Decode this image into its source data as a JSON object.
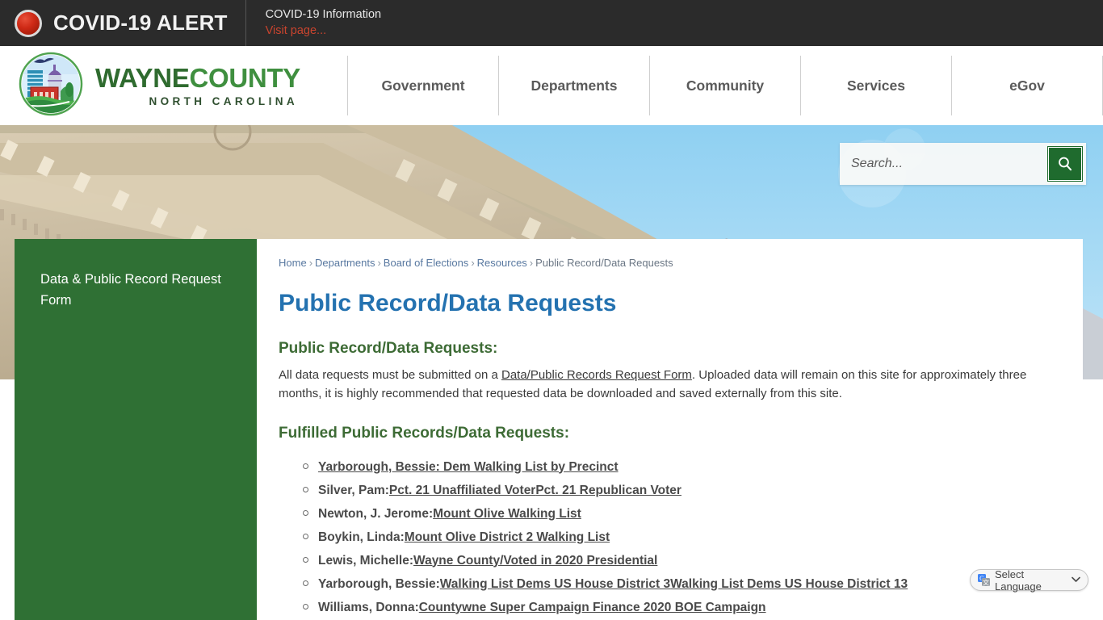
{
  "alert": {
    "icon": "red-alert-dot-icon",
    "title": "COVID-19 ALERT",
    "info": "COVID-19 Information",
    "link": "Visit page..."
  },
  "header": {
    "logo": {
      "icon": "wayne-county-seal-icon",
      "word1": "WAYNE",
      "word2": "COUNTY",
      "state": "NORTH CAROLINA"
    },
    "nav": [
      {
        "label": "Government"
      },
      {
        "label": "Departments"
      },
      {
        "label": "Community"
      },
      {
        "label": "Services"
      },
      {
        "label": "eGov"
      }
    ]
  },
  "hero": {
    "search": {
      "placeholder": "Search...",
      "value": "",
      "button_icon": "search-icon",
      "button_color": "#1f6b2e"
    }
  },
  "sidebar": {
    "background": "#2f7034",
    "items": [
      {
        "label": "Data & Public Record Request Form"
      }
    ]
  },
  "main": {
    "breadcrumb": [
      {
        "label": "Home",
        "current": false
      },
      {
        "label": "Departments",
        "current": false
      },
      {
        "label": "Board of Elections",
        "current": false
      },
      {
        "label": "Resources",
        "current": false
      },
      {
        "label": "Public Record/Data Requests",
        "current": true
      }
    ],
    "breadcrumb_separator": "›",
    "page_title": "Public Record/Data Requests",
    "title_color": "#2472b0",
    "heading_color": "#3d6b35",
    "section_one": {
      "heading": "Public Record/Data Requests:",
      "text_before": "All data requests must be submitted on a ",
      "link": "Data/Public Records Request Form",
      "text_after": ". Uploaded data will remain on this site for approximately three months, it is highly recommended that requested data be downloaded and saved externally from this site."
    },
    "section_two": {
      "heading": "Fulfilled Public Records/Data Requests:",
      "records": [
        {
          "name": "",
          "links": [
            "Yarborough, Bessie: Dem Walking List by Precinct"
          ]
        },
        {
          "name": "Silver, Pam: ",
          "links": [
            "Pct. 21 Unaffiliated Voter",
            "Pct. 21 Republican Voter"
          ]
        },
        {
          "name": "Newton, J. Jerome: ",
          "links": [
            "Mount Olive Walking List"
          ]
        },
        {
          "name": "Boykin, Linda: ",
          "links": [
            "Mount Olive District 2 Walking List"
          ]
        },
        {
          "name": "Lewis, Michelle: ",
          "links": [
            "Wayne County/Voted in 2020 Presidential"
          ]
        },
        {
          "name": "Yarborough, Bessie: ",
          "links": [
            "Walking List Dems US House District 3",
            " Walking List Dems US House District 13"
          ]
        },
        {
          "name": "Williams, Donna: ",
          "links": [
            "Countywne Super Campaign Finance 2020 BOE Campaign"
          ]
        }
      ]
    }
  },
  "translate": {
    "icon": "google-translate-icon",
    "label": "Select Language",
    "caret": "∨"
  }
}
